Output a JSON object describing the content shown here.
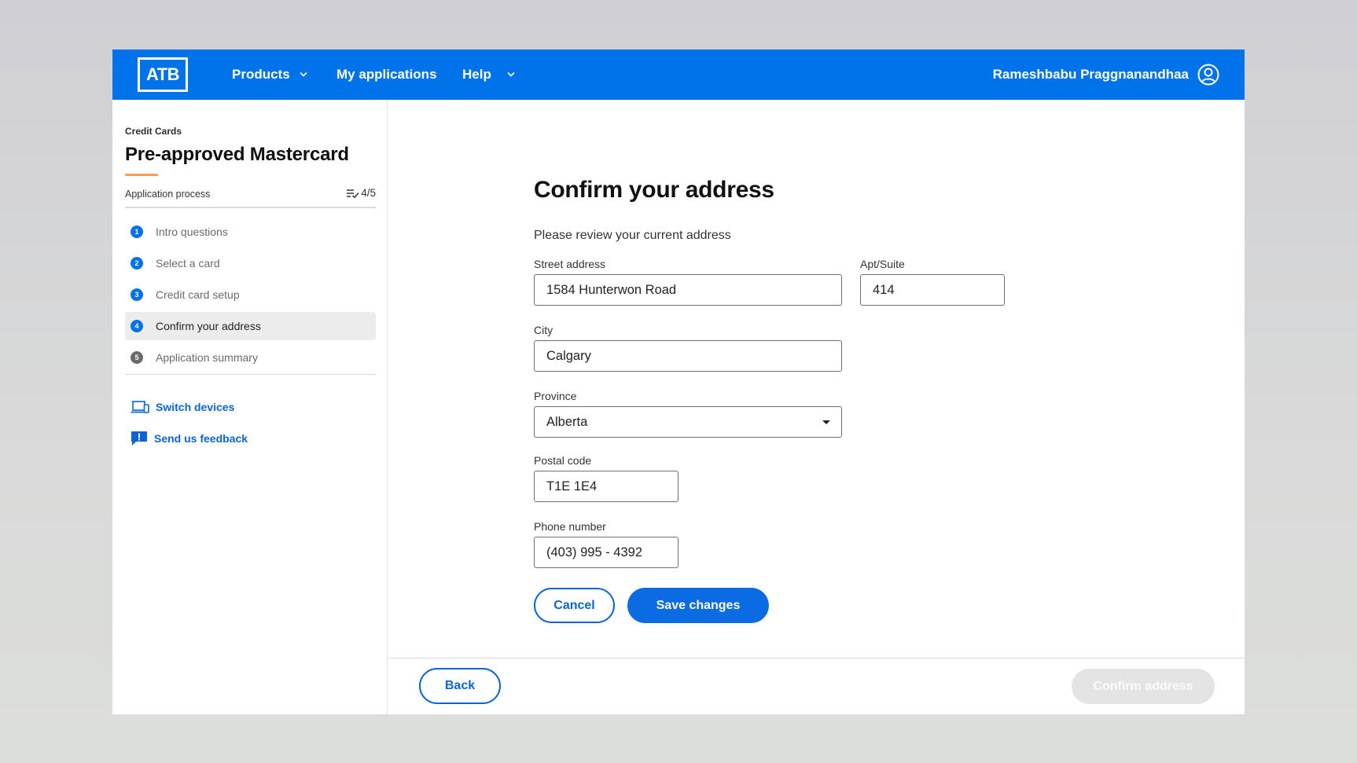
{
  "header": {
    "logo_text": "ATB",
    "nav": {
      "products": "Products",
      "my_applications": "My applications",
      "help": "Help"
    },
    "user_name": "Rameshbabu Praggnanandhaa"
  },
  "sidebar": {
    "category": "Credit Cards",
    "title": "Pre-approved Mastercard",
    "process_label": "Application process",
    "progress": "4/5",
    "steps": [
      {
        "num": "1",
        "label": "Intro questions"
      },
      {
        "num": "2",
        "label": "Select a card"
      },
      {
        "num": "3",
        "label": "Credit card setup"
      },
      {
        "num": "4",
        "label": "Confirm your address"
      },
      {
        "num": "5",
        "label": "Application summary"
      }
    ],
    "switch_devices": "Switch devices",
    "send_feedback": "Send us feedback"
  },
  "form": {
    "heading": "Confirm your address",
    "intro": "Please review your current address",
    "street": {
      "label": "Street address",
      "value": "1584 Hunterwon Road"
    },
    "apt": {
      "label": "Apt/Suite",
      "value": "414"
    },
    "city": {
      "label": "City",
      "value": "Calgary"
    },
    "province": {
      "label": "Province",
      "value": "Alberta"
    },
    "postal": {
      "label": "Postal code",
      "value": "T1E 1E4"
    },
    "phone": {
      "label": "Phone number",
      "value": "(403) 995 - 4392"
    },
    "cancel": "Cancel",
    "save": "Save changes"
  },
  "footer": {
    "back": "Back",
    "confirm": "Confirm address"
  },
  "colors": {
    "brand_blue": "#0072ea",
    "link_blue": "#0a64d8",
    "accent_orange": "#ff9a4d",
    "disabled": "#e4e4e4"
  },
  "icons": [
    "user-circle-icon",
    "chevron-down-icon",
    "checklist-icon",
    "devices-icon",
    "feedback-icon",
    "dropdown-caret-icon"
  ]
}
